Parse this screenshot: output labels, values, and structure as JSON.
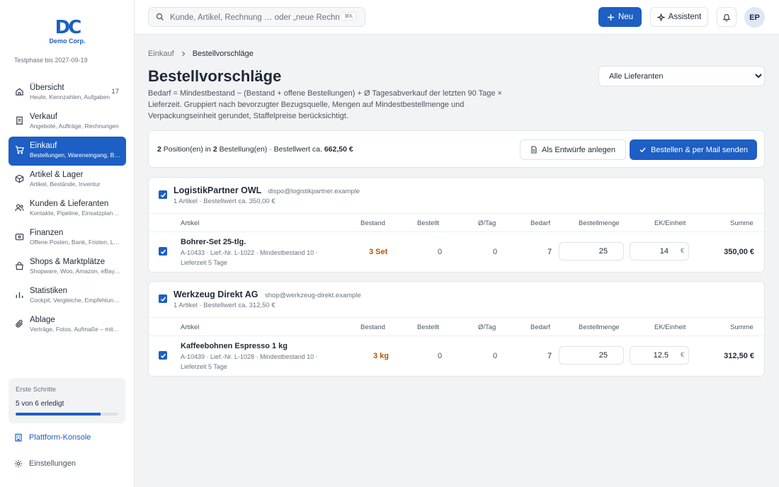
{
  "brand": {
    "logo_text": "DC",
    "name": "Demo Corp.",
    "trial": "Testphase bis 2027-09-19",
    "primary_color": "#1d5fc4"
  },
  "sidebar": {
    "items": [
      {
        "label": "Übersicht",
        "sub": "Heute, Kennzahlen, Aufgaben",
        "badge": "17",
        "icon": "home-icon"
      },
      {
        "label": "Verkauf",
        "sub": "Angebote, Aufträge, Rechnungen",
        "icon": "receipt-icon"
      },
      {
        "label": "Einkauf",
        "sub": "Bestellungen, Wareneingang, Bestellvorschläge",
        "icon": "cart-icon",
        "active": true
      },
      {
        "label": "Artikel & Lager",
        "sub": "Artikel, Bestände, Inventur",
        "icon": "box-icon"
      },
      {
        "label": "Kunden & Lieferanten",
        "sub": "Kontakte, Pipeline, Einsatzplan, Kalender",
        "icon": "users-icon"
      },
      {
        "label": "Finanzen",
        "sub": "Offene Posten, Bank, Fristen, Lieferanten",
        "icon": "wallet-icon"
      },
      {
        "label": "Shops & Marktplätze",
        "sub": "Shopware, Woo, Amazon, eBay, Etsy",
        "icon": "shop-icon"
      },
      {
        "label": "Statistiken",
        "sub": "Cockpit, Vergleiche, Empfehlungen",
        "icon": "chart-icon"
      },
      {
        "label": "Ablage",
        "sub": "Verträge, Fotos, Aufmaße – mit Suche",
        "icon": "paperclip-icon"
      }
    ],
    "onboarding": {
      "title": "Erste Schritte",
      "progress_text": "5 von 6 erledigt",
      "progress": 0.83
    },
    "platform_label": "Plattform-Konsole",
    "settings_label": "Einstellungen"
  },
  "topbar": {
    "search_placeholder": "Kunde, Artikel, Rechnung … oder „neue Rechnung“",
    "search_shortcut": "⌘K",
    "new_label": "Neu",
    "assistant_label": "Assistent",
    "avatar_initials": "EP"
  },
  "breadcrumb": {
    "parent": "Einkauf",
    "current": "Bestellvorschläge"
  },
  "page": {
    "title": "Bestellvorschläge",
    "description": "Bedarf = Mindestbestand − (Bestand + offene Bestellungen) + Ø Tagesabverkauf der letzten 90 Tage × Lieferzeit. Gruppiert nach bevorzugter Bezugsquelle, Mengen auf Mindestbestellmenge und Verpackungseinheit gerundet, Staffelpreise berücksichtigt.",
    "supplier_filter": "Alle Lieferanten"
  },
  "summary": {
    "positions": "2",
    "positions_label": "Position(en) in",
    "orders": "2",
    "orders_label": "Bestellung(en) · Bestellwert ca.",
    "value": "662,50 €",
    "draft_button": "Als Entwürfe anlegen",
    "order_button": "Bestellen & per Mail senden"
  },
  "columns": [
    "Artikel",
    "Bestand",
    "Bestellt",
    "Ø/Tag",
    "Bedarf",
    "Bestellmenge",
    "EK/Einheit",
    "Summe"
  ],
  "groups": [
    {
      "supplier": "LogistikPartner OWL",
      "email": "dispo@logistikpartner.example",
      "sub": "1 Artikel · Bestellwert ca. 350,00 €",
      "row": {
        "name": "Bohrer-Set 25-tlg.",
        "meta": "A-10433 · Lief.-Nr. L-1022 · Mindestbestand 10 · Lieferzeit 5 Tage",
        "stock": "3 Set",
        "ordered": "0",
        "per_day": "0",
        "need": "7",
        "qty": "25",
        "price": "14",
        "currency": "€",
        "sum": "350,00 €"
      }
    },
    {
      "supplier": "Werkzeug Direkt AG",
      "email": "shop@werkzeug-direkt.example",
      "sub": "1 Artikel · Bestellwert ca. 312,50 €",
      "row": {
        "name": "Kaffeebohnen Espresso 1 kg",
        "meta": "A-10439 · Lief.-Nr. L-1028 · Mindestbestand 10 · Lieferzeit 5 Tage",
        "stock": "3 kg",
        "ordered": "0",
        "per_day": "0",
        "need": "7",
        "qty": "25",
        "price": "12.5",
        "currency": "€",
        "sum": "312,50 €"
      }
    }
  ]
}
